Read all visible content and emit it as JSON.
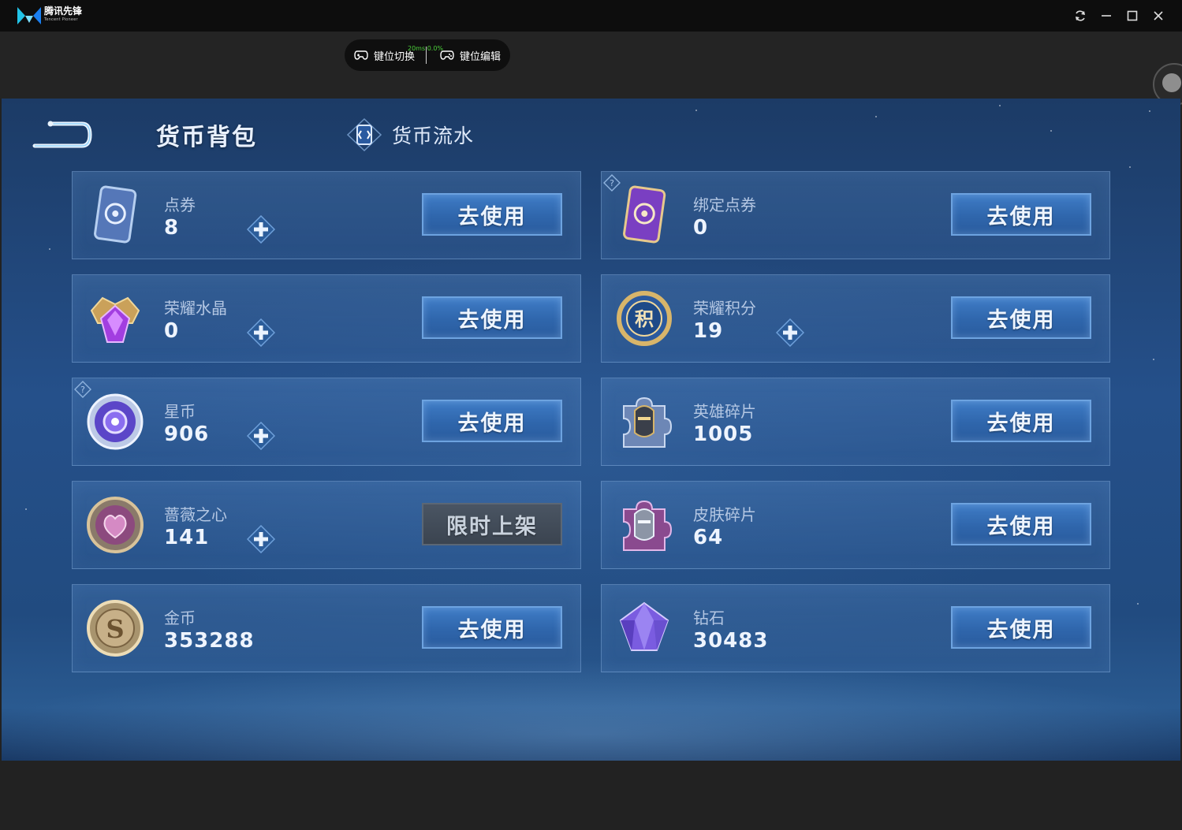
{
  "app": {
    "name": "腾讯先锋",
    "subtitle": "Tencent Pioneer"
  },
  "toolbar": {
    "key_switch": "键位切换",
    "key_edit": "键位编辑",
    "ping": "20ms",
    "loss": "0.0%"
  },
  "page": {
    "title": "货币背包",
    "flow_tab": "货币流水"
  },
  "cards": [
    {
      "name": "点券",
      "value": "8",
      "button": "去使用",
      "icon": "voucher-card-icon",
      "plus": true,
      "help": false,
      "disabled": false
    },
    {
      "name": "绑定点券",
      "value": "0",
      "button": "去使用",
      "icon": "bound-voucher-card-icon",
      "plus": false,
      "help": true,
      "disabled": false
    },
    {
      "name": "荣耀水晶",
      "value": "0",
      "button": "去使用",
      "icon": "glory-crystal-icon",
      "plus": true,
      "help": false,
      "disabled": false
    },
    {
      "name": "荣耀积分",
      "value": "19",
      "button": "去使用",
      "icon": "glory-points-medal-icon",
      "plus": true,
      "help": false,
      "disabled": false
    },
    {
      "name": "星币",
      "value": "906",
      "button": "去使用",
      "icon": "star-coin-icon",
      "plus": true,
      "help": true,
      "disabled": false
    },
    {
      "name": "英雄碎片",
      "value": "1005",
      "button": "去使用",
      "icon": "hero-fragment-icon",
      "plus": false,
      "help": false,
      "disabled": false
    },
    {
      "name": "蔷薇之心",
      "value": "141",
      "button": "限时上架",
      "icon": "rose-heart-coin-icon",
      "plus": true,
      "help": false,
      "disabled": true
    },
    {
      "name": "皮肤碎片",
      "value": "64",
      "button": "去使用",
      "icon": "skin-fragment-icon",
      "plus": false,
      "help": false,
      "disabled": false
    },
    {
      "name": "金币",
      "value": "353288",
      "button": "去使用",
      "icon": "gold-coin-icon",
      "plus": false,
      "help": false,
      "disabled": false
    },
    {
      "name": "钻石",
      "value": "30483",
      "button": "去使用",
      "icon": "diamond-icon",
      "plus": false,
      "help": false,
      "disabled": false
    }
  ]
}
